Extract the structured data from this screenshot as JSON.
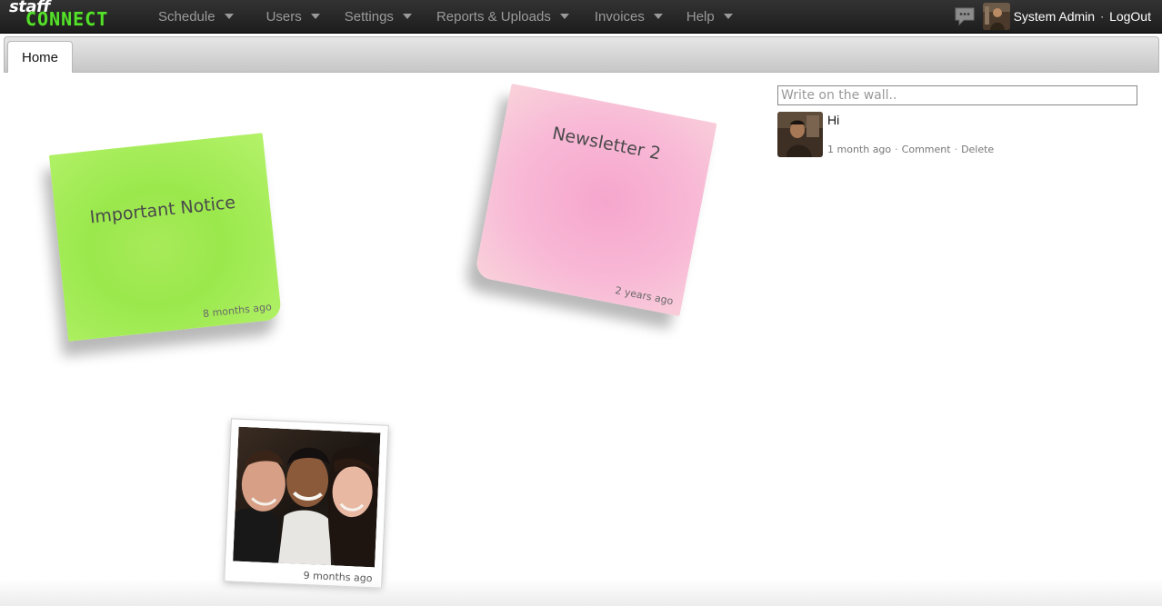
{
  "app": {
    "logo_top": "staff",
    "logo_bottom": "CONNECT"
  },
  "nav": {
    "items": [
      {
        "label": "Schedule"
      },
      {
        "label": "Users"
      },
      {
        "label": "Settings"
      },
      {
        "label": "Reports & Uploads"
      },
      {
        "label": "Invoices"
      },
      {
        "label": "Help"
      }
    ],
    "user_name": "System Admin",
    "separator": "·",
    "logout_label": "LogOut",
    "chat_icon": "chat-bubble-icon"
  },
  "tabs": [
    {
      "label": "Home",
      "active": true
    }
  ],
  "board": {
    "notes": [
      {
        "title": "Important Notice",
        "time": "8 months ago",
        "color": "#9ae84c"
      },
      {
        "title": "Newsletter 2",
        "time": "2 years ago",
        "color": "#f6a6cc"
      }
    ],
    "photo": {
      "time": "9 months ago"
    }
  },
  "wall": {
    "placeholder": "Write on the wall..",
    "posts": [
      {
        "message": "Hi",
        "time": "1 month ago",
        "comment_label": "Comment",
        "delete_label": "Delete",
        "separator": "·"
      }
    ]
  }
}
